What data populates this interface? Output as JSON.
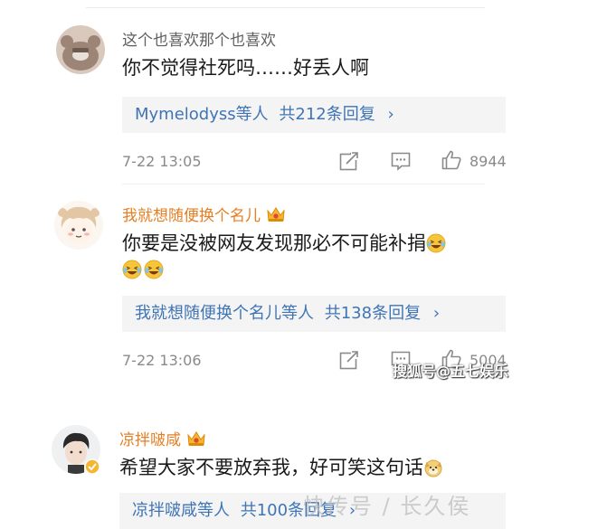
{
  "comments": [
    {
      "username": "这个也喜欢那个也喜欢",
      "content": "你不觉得社死吗……好丢人啊",
      "reply_users": "Mymelodyss等人",
      "reply_count": "共212条回复",
      "time": "7-22 13:05",
      "likes": "8944"
    },
    {
      "username": "我就想随便换个名儿",
      "content": "你要是没被网友发现那必不可能补捐",
      "reply_users": "我就想随便换个名儿等人",
      "reply_count": "共138条回复",
      "time": "7-22 13:06",
      "likes": "5004"
    },
    {
      "username": "凉拌啵咸",
      "content": "希望大家不要放弃我，好可笑这句话",
      "reply_users": "凉拌啵咸等人",
      "reply_count": "共100条回复"
    }
  ],
  "chevron": "›",
  "watermarks": {
    "sohu": "搜狐号@五七娱乐",
    "bottom": "快传号 / 长久侯"
  },
  "colors": {
    "link_blue": "#3f74b5",
    "vip_orange": "#e67e22",
    "meta_gray": "#8a8a8a",
    "reply_bg": "#f4f4f4"
  },
  "icons": [
    "repost-icon",
    "comment-icon",
    "like-icon",
    "crown-icon",
    "verified-badge-icon",
    "laugh-emoji-icon",
    "dog-emoji-icon"
  ]
}
